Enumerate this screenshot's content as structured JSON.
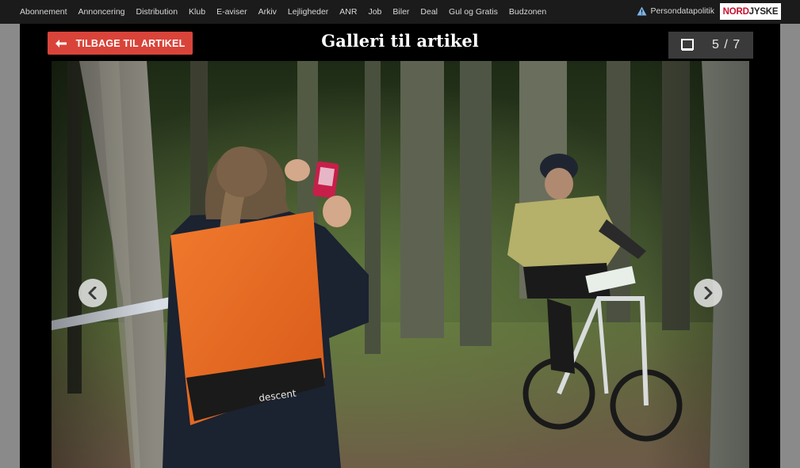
{
  "nav": {
    "items": [
      "Abonnement",
      "Annoncering",
      "Distribution",
      "Klub",
      "E-aviser",
      "Arkiv",
      "Lejligheder",
      "ANR",
      "Job",
      "Biler",
      "Deal",
      "Gul og Gratis",
      "Budzonen"
    ],
    "privacy_label": "Persondatapolitik",
    "logo_part1": "NORD",
    "logo_part2": "JYSKE"
  },
  "gallery": {
    "back_label": "TILBAGE TIL ARTIKEL",
    "title": "Galleri til artikel",
    "counter": "5 / 7",
    "photo_alt": "Kvinde med orange rygsæk fotograferer mountainbikerytter i skoven",
    "backpack_brand": "descent"
  },
  "icons": {
    "back": "arrow-left-icon",
    "privacy": "warning-triangle-icon",
    "counter": "frame-icon",
    "prev": "chevron-left-icon",
    "next": "chevron-right-icon"
  },
  "colors": {
    "accent": "#d9443a",
    "topbar_bg": "#1b1b1b",
    "gallery_bg": "#000000",
    "counter_bg": "#3a3a3a",
    "page_bg": "#8a8a8a"
  }
}
